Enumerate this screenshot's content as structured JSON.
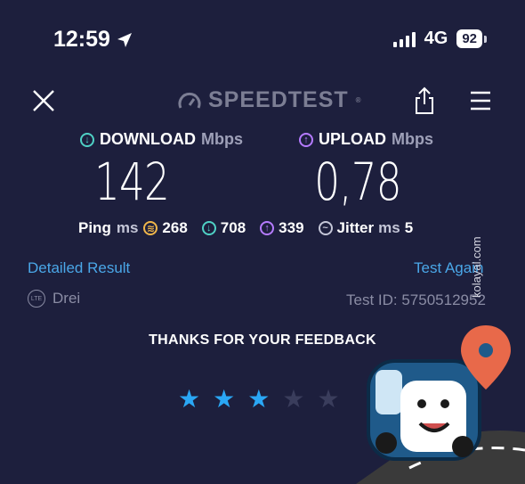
{
  "status_bar": {
    "time": "12:59",
    "network": "4G",
    "battery": "92"
  },
  "header": {
    "logo_text": "SPEEDTEST",
    "close_icon": "close-icon",
    "share_icon": "share-icon",
    "menu_icon": "menu-icon"
  },
  "download": {
    "label": "DOWNLOAD",
    "unit": "Mbps",
    "value": "142",
    "color": "#4fd1c5"
  },
  "upload": {
    "label": "UPLOAD",
    "unit": "Mbps",
    "value": "0,78",
    "color": "#b57bff"
  },
  "ping": {
    "label": "Ping",
    "unit": "ms",
    "idle": "268",
    "download": "708",
    "upload": "339",
    "idle_color": "#f0b64a"
  },
  "jitter": {
    "label": "Jitter",
    "unit": "ms",
    "value": "5"
  },
  "links": {
    "detailed": "Detailed Result",
    "test_again": "Test Again"
  },
  "provider": {
    "badge": "LTE",
    "name": "Drei",
    "test_id": "Test ID: 5750512952"
  },
  "feedback": {
    "title": "THANKS FOR YOUR FEEDBACK",
    "rating": 3,
    "max": 5,
    "active_color": "#2aa7f5",
    "inactive_color": "#3a3d5c"
  },
  "watermark": "kolayal.com"
}
